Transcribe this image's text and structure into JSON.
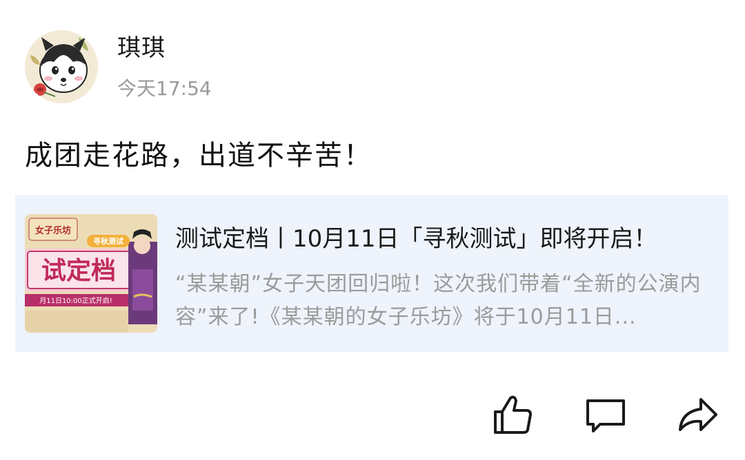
{
  "author": {
    "name": "琪琪",
    "time": "今天17:54",
    "avatar_icon": "husky-dog-avatar"
  },
  "post": {
    "text": "成团走花路，出道不辛苦！"
  },
  "link_card": {
    "title": "测试定档丨10月11日「寻秋测试」即将开启！",
    "summary": "“某某朝”女子天团回归啦！这次我们带着“全新的公演内容”来了!《某某朝的女子乐坊》将于10月11日...",
    "thumb": {
      "logo_text": "女子乐坊",
      "headline": "试定档",
      "tag": "寻秋测试",
      "subline": "月11日10:00正式开启!"
    }
  },
  "actions": {
    "like_icon": "thumbs-up-icon",
    "comment_icon": "comment-icon",
    "share_icon": "share-icon"
  },
  "colors": {
    "card_bg": "#eef3fc",
    "secondary_text": "#9b9b9b",
    "icon_stroke": "#1a1a1a"
  }
}
